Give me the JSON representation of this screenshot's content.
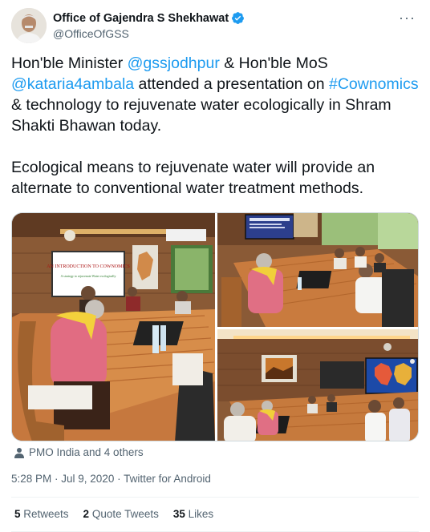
{
  "author": {
    "display_name": "Office of Gajendra S Shekhawat",
    "handle": "@OfficeOfGSS",
    "verified": true
  },
  "menu_icon": "more-dots-icon",
  "tweet": {
    "para1": {
      "t1": "Hon'ble Minister ",
      "m1": "@gssjodhpur",
      "t2": " & Hon'ble MoS ",
      "m2": "@kataria4ambala",
      "t3": " attended a presentation on ",
      "h1": "#Cownomics",
      "t4": " & technology to rejuvenate water ecologically in Shram Shakti Bhawan today."
    },
    "para2": "Ecological means to rejuvenate water will provide an alternate to conventional water treatment methods."
  },
  "media": {
    "slide_text": "AN INTRODUCTION TO COWNOMICS",
    "slide_subtext": "A strategy to rejuvenate Water ecologically"
  },
  "tagged": "PMO India and 4 others",
  "meta": {
    "time": "5:28 PM",
    "sep": " · ",
    "date": "Jul 9, 2020",
    "sep2": " · ",
    "source": "Twitter for Android"
  },
  "stats": {
    "retweets_count": "5",
    "retweets_label": " Retweets",
    "quotes_count": "2",
    "quotes_label": " Quote Tweets",
    "likes_count": "35",
    "likes_label": " Likes"
  },
  "colors": {
    "link": "#1d9bf0",
    "muted": "#536471",
    "verified": "#1d9bf0"
  }
}
